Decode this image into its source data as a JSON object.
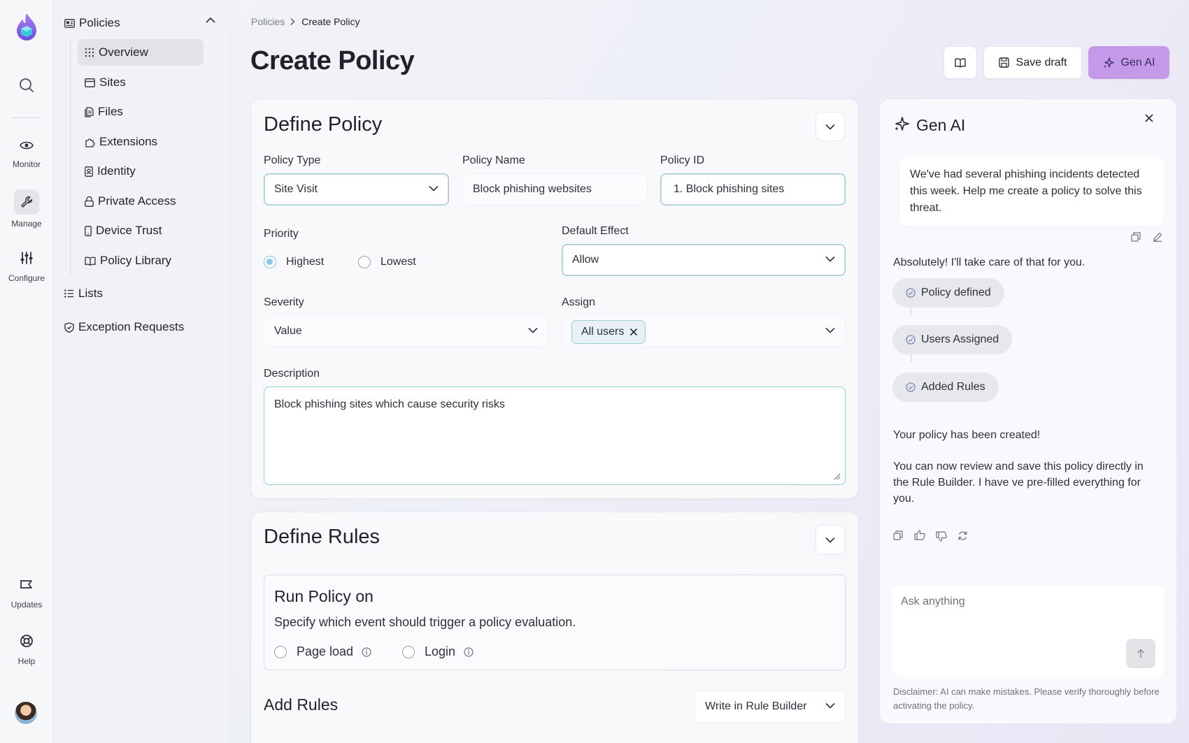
{
  "rail": {
    "monitor": "Monitor",
    "manage": "Manage",
    "configure": "Configure",
    "updates": "Updates",
    "help": "Help"
  },
  "sidebar": {
    "section": "Policies",
    "items": [
      {
        "label": "Overview",
        "icon": "grid-icon",
        "active": true
      },
      {
        "label": "Sites",
        "icon": "browser-icon"
      },
      {
        "label": "Files",
        "icon": "file-icon"
      },
      {
        "label": "Extensions",
        "icon": "puzzle-icon"
      },
      {
        "label": "Identity",
        "icon": "id-badge-icon"
      },
      {
        "label": "Private Access",
        "icon": "lock-icon"
      },
      {
        "label": "Device Trust",
        "icon": "phone-icon"
      },
      {
        "label": "Policy Library",
        "icon": "book-icon"
      }
    ],
    "lists": "Lists",
    "exceptions": "Exception Requests"
  },
  "breadcrumb": {
    "parent": "Policies",
    "current": "Create Policy"
  },
  "page_title": "Create Policy",
  "toolbar": {
    "save_draft": "Save draft",
    "gen_ai": "Gen AI"
  },
  "define_policy": {
    "title": "Define Policy",
    "policy_type_label": "Policy Type",
    "policy_type_value": "Site Visit",
    "policy_name_label": "Policy Name",
    "policy_name_value": "Block phishing websites",
    "policy_id_label": "Policy ID",
    "policy_id_value": "1. Block phishing sites",
    "priority_label": "Priority",
    "priority_highest": "Highest",
    "priority_lowest": "Lowest",
    "default_effect_label": "Default Effect",
    "default_effect_value": "Allow",
    "severity_label": "Severity",
    "severity_value": "Value",
    "assign_label": "Assign",
    "assign_chip": "All users",
    "description_label": "Description",
    "description_value": "Block phishing sites which cause security risks"
  },
  "define_rules": {
    "title": "Define Rules",
    "run_title": "Run Policy on",
    "run_sub": "Specify which event should trigger a policy evaluation.",
    "opt_page_load": "Page load",
    "opt_login": "Login",
    "add_rules": "Add Rules",
    "rule_builder": "Write in Rule Builder"
  },
  "gen_ai": {
    "title": "Gen AI",
    "user_message": "We've had several phishing incidents detected this week. Help me create a policy to solve this threat.",
    "reply": "Absolutely! I'll take care of that for you.",
    "steps": [
      "Policy defined",
      "Users Assigned",
      "Added Rules"
    ],
    "created": "Your policy has been created!",
    "review": "You can now review and save this policy directly in the Rule Builder. I have ve pre-filled everything for you.",
    "ask_placeholder": "Ask anything",
    "disclaimer": "Disclaimer: AI can make mistakes. Please verify thoroughly before activating the policy."
  },
  "colors": {
    "accent": "#c49ae8",
    "focus": "#8fd6c9",
    "radio": "#86c9e8"
  }
}
